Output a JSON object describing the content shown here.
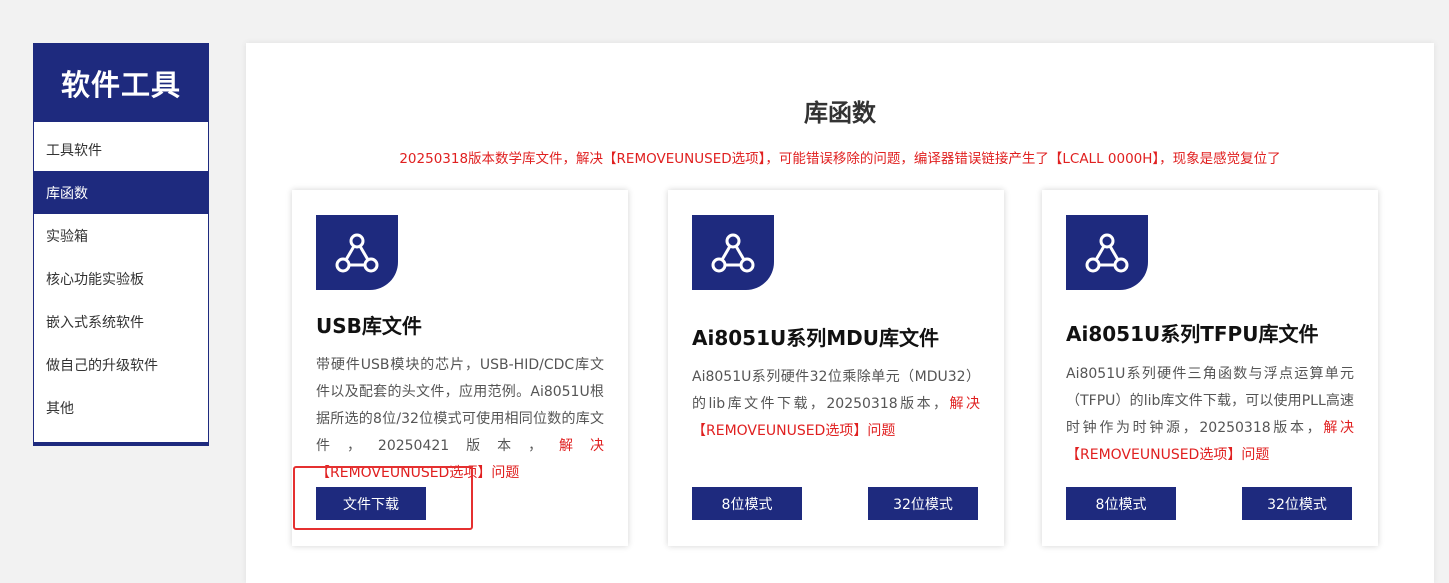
{
  "sidebar": {
    "title": "软件工具",
    "items": [
      {
        "label": "工具软件",
        "active": false
      },
      {
        "label": "库函数",
        "active": true
      },
      {
        "label": "实验箱",
        "active": false
      },
      {
        "label": "核心功能实验板",
        "active": false
      },
      {
        "label": "嵌入式系统软件",
        "active": false
      },
      {
        "label": "做自己的升级软件",
        "active": false
      },
      {
        "label": "其他",
        "active": false
      }
    ]
  },
  "main": {
    "title": "库函数",
    "notice": "20250318版本数学库文件，解决【REMOVEUNUSED选项】，可能错误移除的问题，编译器错误链接产生了【LCALL 0000H】，现象是感觉复位了",
    "cards": [
      {
        "icon": "share-nodes-icon",
        "title": "USB库文件",
        "desc_main": "带硬件USB模块的芯片，USB-HID/CDC库文件以及配套的头文件，应用范例。Ai8051U根据所选的8位/32位模式可使用相同位数的库文件，20250421版本，",
        "desc_red": "解决【REMOVEUNUSED选项】问题",
        "buttons": [
          "文件下载"
        ]
      },
      {
        "icon": "share-nodes-icon",
        "title": "Ai8051U系列MDU库文件",
        "desc_main": "Ai8051U系列硬件32位乘除单元（MDU32）的lib库文件下载，20250318版本，",
        "desc_red": "解决【REMOVEUNUSED选项】问题",
        "buttons": [
          "8位模式",
          "32位模式"
        ]
      },
      {
        "icon": "share-nodes-icon",
        "title": "Ai8051U系列TFPU库文件",
        "desc_main": "Ai8051U系列硬件三角函数与浮点运算单元（TFPU）的lib库文件下载，可以使用PLL高速时钟作为时钟源，20250318版本，",
        "desc_red": "解决【REMOVEUNUSED选项】问题",
        "buttons": [
          "8位模式",
          "32位模式"
        ]
      }
    ]
  },
  "colors": {
    "brand": "#1e2a7e",
    "alert": "#e02020"
  }
}
